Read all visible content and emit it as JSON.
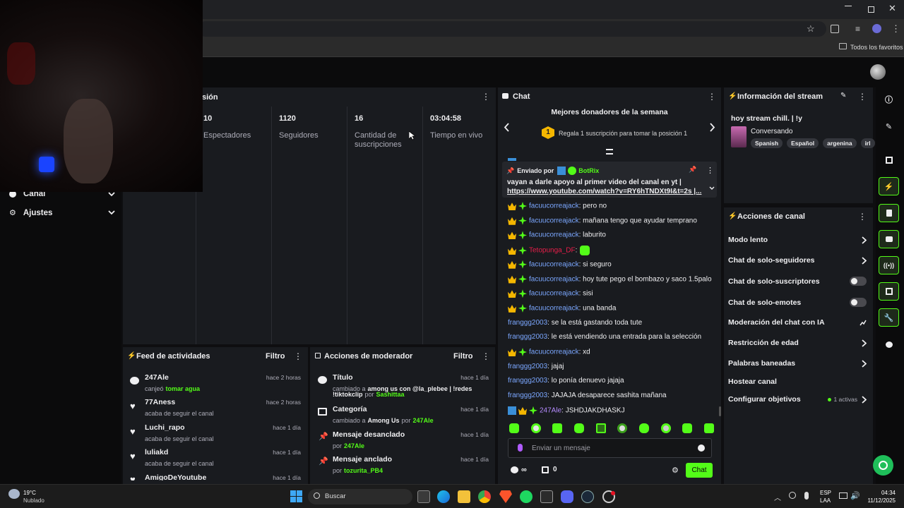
{
  "browser": {
    "favorites_label": "Todos los favoritos"
  },
  "stream_panel": {
    "title_fragment": "sión",
    "stats": [
      {
        "value": "10",
        "label": "Espectadores"
      },
      {
        "value": "1120",
        "label": "Seguidores"
      },
      {
        "value": "16",
        "label": "Cantidad de suscripciones"
      },
      {
        "value": "03:04:58",
        "label": "Tiempo en vivo"
      }
    ]
  },
  "left_nav": {
    "items": [
      {
        "label": "Canal",
        "icon": "user-icon"
      },
      {
        "label": "Ajustes",
        "icon": "gear-icon"
      }
    ]
  },
  "chat": {
    "title": "Chat",
    "donors_title": "Mejores donadores de la semana",
    "donor_rank": "1",
    "donor_text": "Regala 1 suscripción para tomar la posición 1",
    "pinned_sent_by": "Enviado por",
    "pinned_user": "BotRix",
    "pinned_line1": "vayan a darle apoyo al primer video del canal en yt |",
    "pinned_line2": "https://www.youtube.com/watch?v=RY6hTNDXt9I&t=2s |...",
    "messages": [
      {
        "user": "facuucorreajack",
        "text": ": pero no",
        "badges": true,
        "color": "blue"
      },
      {
        "user": "facuucorreajack",
        "text": ": mañana tengo que ayudar temprano",
        "badges": true,
        "color": "blue"
      },
      {
        "user": "facuucorreajack",
        "text": ": laburito",
        "badges": true,
        "color": "blue"
      },
      {
        "user": "Tetopunga_DF",
        "text": ":",
        "badges": true,
        "color": "red"
      },
      {
        "user": "facuucorreajack",
        "text": ": si seguro",
        "badges": true,
        "color": "blue"
      },
      {
        "user": "facuucorreajack",
        "text": ": hoy tute pego el bombazo y saco 1.5palo",
        "badges": true,
        "color": "blue"
      },
      {
        "user": "facuucorreajack",
        "text": ": sisi",
        "badges": true,
        "color": "blue"
      },
      {
        "user": "facuucorreajack",
        "text": ": una banda",
        "badges": true,
        "color": "blue"
      },
      {
        "user": "franggg2003",
        "text": ": se la está gastando toda tute",
        "badges": false,
        "color": "blue"
      },
      {
        "user": "franggg2003",
        "text": ": le está vendiendo una entrada para la selección",
        "badges": false,
        "color": "blue"
      },
      {
        "user": "facuucorreajack",
        "text": ": xd",
        "badges": true,
        "color": "blue"
      },
      {
        "user": "franggg2003",
        "text": ": jajaj",
        "badges": false,
        "color": "blue"
      },
      {
        "user": "franggg2003",
        "text": ": lo ponía denuevo jajaja",
        "badges": false,
        "color": "blue"
      },
      {
        "user": "franggg2003",
        "text": ": JAJAJA desaparece sashita mañana",
        "badges": false,
        "color": "blue"
      },
      {
        "user": "247Ale",
        "text": ": JSHDJAKDHASKJ",
        "badges": true,
        "color": "purple"
      }
    ],
    "input_placeholder": "Enviar un mensaje",
    "infinity_label": "∞",
    "gift_count": "0",
    "send_label": "Chat"
  },
  "stream_info": {
    "title": "Información del stream",
    "stream_title": "hoy stream chill. | !y",
    "category": "Conversando",
    "tags": [
      "Spanish",
      "Español",
      "argenina",
      "irl"
    ]
  },
  "channel_actions": {
    "title": "Acciones de canal",
    "items": [
      {
        "label": "Modo lento",
        "control": "chevron"
      },
      {
        "label": "Chat de solo-seguidores",
        "control": "chevron"
      },
      {
        "label": "Chat de solo-suscriptores",
        "control": "toggle"
      },
      {
        "label": "Chat de solo-emotes",
        "control": "toggle"
      },
      {
        "label": "Moderación del chat con IA",
        "control": "external"
      },
      {
        "label": "Restricción de edad",
        "control": "chevron"
      },
      {
        "label": "Palabras baneadas",
        "control": "chevron"
      },
      {
        "label": "Hostear canal",
        "control": "none"
      },
      {
        "label": "Configurar objetivos",
        "control": "goals"
      }
    ],
    "goals_active": "1 activas"
  },
  "activity_feed": {
    "title": "Feed de actividades",
    "filter_label": "Filtro",
    "items": [
      {
        "user": "247Ale",
        "action": "canjeó",
        "extra": "tomar agua",
        "time": "hace 2 horas",
        "icon": "points-icon"
      },
      {
        "user": "77Aness",
        "action": "acaba de seguir el canal",
        "extra": "",
        "time": "hace 2 horas",
        "icon": "heart-icon"
      },
      {
        "user": "Luchi_rapo",
        "action": "acaba de seguir el canal",
        "extra": "",
        "time": "hace 1 día",
        "icon": "heart-icon"
      },
      {
        "user": "luliakd",
        "action": "acaba de seguir el canal",
        "extra": "",
        "time": "hace 1 día",
        "icon": "heart-icon"
      },
      {
        "user": "AmigoDeYoutube",
        "action": "",
        "extra": "",
        "time": "hace 1 día",
        "icon": "heart-icon"
      }
    ]
  },
  "mod_actions": {
    "title": "Acciones de moderador",
    "filter_label": "Filtro",
    "items": [
      {
        "title": "Título",
        "line1_prefix": "cambiado a",
        "line1_value": "among us con @la_plebee | !redes",
        "line2": "!tiktokclip",
        "by": "por",
        "user": "Sashittaa",
        "time": "hace 1 día"
      },
      {
        "title": "Categoría",
        "line1_prefix": "cambiado a",
        "line1_value": "Among Us",
        "line2": "",
        "by": "por",
        "user": "247Ale",
        "time": "hace 1 día"
      },
      {
        "title": "Mensaje desanclado",
        "line1_prefix": "",
        "line1_value": "",
        "line2": "",
        "by": "por",
        "user": "247Ale",
        "time": "hace 1 día"
      },
      {
        "title": "Mensaje anclado",
        "line1_prefix": "",
        "line1_value": "",
        "line2": "",
        "by": "por",
        "user": "tozurita_PB4",
        "time": "hace 1 día"
      }
    ]
  },
  "taskbar": {
    "weather_temp": "19°C",
    "weather_text": "Nublado",
    "search_placeholder": "Buscar",
    "lang1": "ESP",
    "lang2": "LAA",
    "time": "04:34",
    "date": "11/12/2025"
  },
  "colors": {
    "accent": "#53fc18",
    "panel": "#191b1f",
    "background": "#0e0e10",
    "username_blue": "#7ba7ff",
    "username_red": "#e91e4a",
    "username_purple": "#b58cff"
  }
}
